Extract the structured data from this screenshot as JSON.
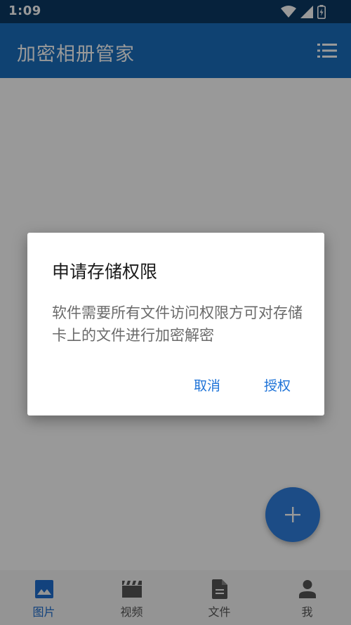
{
  "status_bar": {
    "time": "1:09"
  },
  "app_bar": {
    "title": "加密相册管家"
  },
  "bottom_nav": {
    "items": [
      {
        "label": "图片",
        "icon": "image-icon",
        "active": true
      },
      {
        "label": "视频",
        "icon": "clapperboard-icon",
        "active": false
      },
      {
        "label": "文件",
        "icon": "document-icon",
        "active": false
      },
      {
        "label": "我",
        "icon": "person-icon",
        "active": false
      }
    ]
  },
  "fab": {
    "icon": "plus-icon"
  },
  "dialog": {
    "title": "申请存储权限",
    "message": "软件需要所有文件访问权限方可对存储卡上的文件进行加密解密",
    "cancel_label": "取消",
    "grant_label": "授权"
  },
  "colors": {
    "status_bar": "#0b3a64",
    "app_bar": "#1a6fbf",
    "accent": "#1e73d8",
    "fab": "#2f7fe0"
  }
}
